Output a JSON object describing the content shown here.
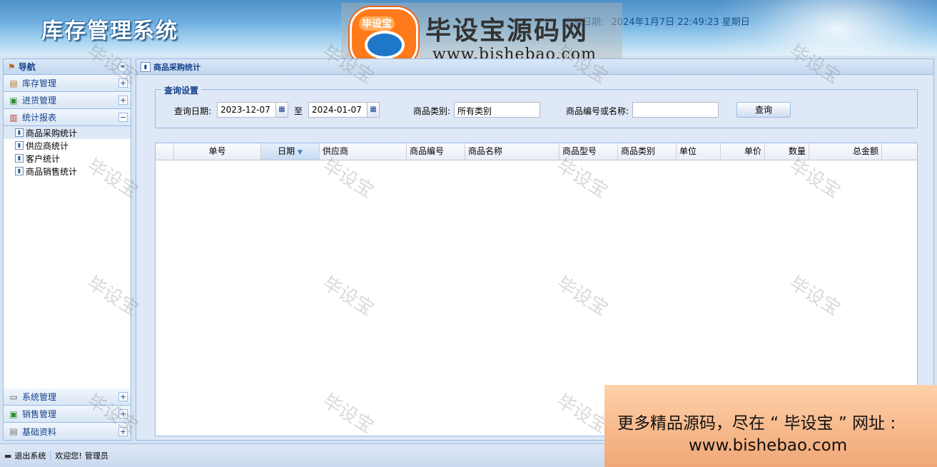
{
  "header": {
    "title": "库存管理系统",
    "datetime_label": "当前日期:",
    "datetime_value": "2024年1月7日 22:49:23 星期日"
  },
  "logo": {
    "badge": "毕设宝",
    "name": "毕设宝源码网",
    "url": "www.bishebao.com"
  },
  "nav": {
    "title": "导航",
    "collapse_icon": "«",
    "groups": [
      {
        "label": "库存管理",
        "icon": "folder-icon"
      },
      {
        "label": "进货管理",
        "icon": "import-icon"
      },
      {
        "label": "统计报表",
        "icon": "chart-icon"
      }
    ],
    "items": [
      {
        "label": "商品采购统计",
        "active": true
      },
      {
        "label": "供应商统计"
      },
      {
        "label": "客户统计"
      },
      {
        "label": "商品销售统计"
      }
    ],
    "bottom_groups": [
      {
        "label": "系统管理"
      },
      {
        "label": "销售管理"
      },
      {
        "label": "基础资料"
      }
    ]
  },
  "panel": {
    "title": "商品采购统计",
    "query": {
      "legend": "查询设置",
      "date_label": "查询日期:",
      "date_from": "2023-12-07",
      "to_label": "至",
      "date_to": "2024-01-07",
      "category_label": "商品类别:",
      "category_value": "所有类别",
      "code_label": "商品编号或名称:",
      "code_value": "",
      "button": "查询"
    },
    "grid": {
      "columns": [
        "",
        "单号",
        "日期",
        "供应商",
        "商品编号",
        "商品名称",
        "商品型号",
        "商品类别",
        "单位",
        "单价",
        "数量",
        "总金额"
      ],
      "sorted_column": "日期",
      "rows": []
    }
  },
  "status": {
    "logout": "退出系统",
    "welcome": "欢迎您!",
    "user": "管理员"
  },
  "watermark": "毕设宝",
  "ad": {
    "line1": "更多精品源码，尽在 “ 毕设宝 ” 网址 :",
    "line2": "www.bishebao.com"
  },
  "colors": {
    "accent": "#15428b",
    "border": "#99bbe8",
    "panel_bg": "#dfe8f6"
  }
}
